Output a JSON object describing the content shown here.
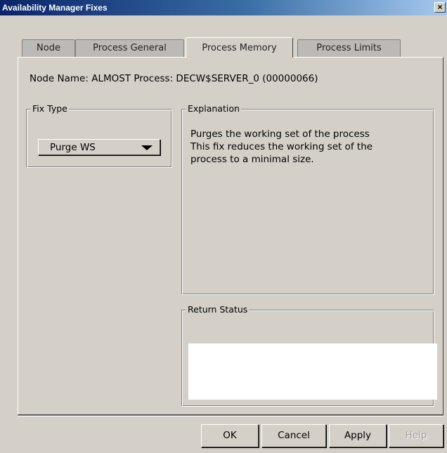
{
  "window": {
    "title": "Availability Manager Fixes",
    "close_label": "×"
  },
  "tabs": [
    {
      "label": "Node",
      "active": false
    },
    {
      "label": "Process General",
      "active": false
    },
    {
      "label": "Process Memory",
      "active": true
    },
    {
      "label": "Process Limits",
      "active": false
    }
  ],
  "node_info": {
    "node_label": "Node Name:",
    "node_value": "ALMOST",
    "process_label": "Process:",
    "process_value": "DECW$SERVER_0 (00000066)"
  },
  "fix_type": {
    "label": "Fix Type",
    "selected": "Purge WS"
  },
  "explanation": {
    "label": "Explanation",
    "line1": "Purges the working set of the process",
    "line2": "This fix reduces the working set of the",
    "line3": "process to a minimal size."
  },
  "return_status": {
    "label": "Return Status",
    "value": ""
  },
  "buttons": {
    "ok": "OK",
    "cancel": "Cancel",
    "apply": "Apply",
    "help": "Help"
  }
}
